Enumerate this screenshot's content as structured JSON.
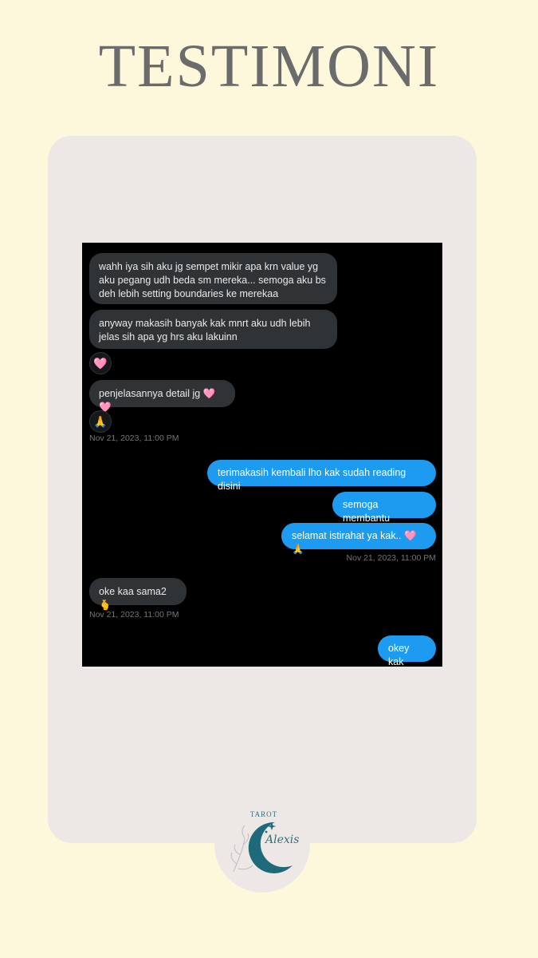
{
  "page": {
    "title": "TESTIMONI",
    "background_color": "#fdf8dc",
    "card_color": "#ede8e5"
  },
  "chat": {
    "incoming": [
      {
        "text": "wahh iya sih aku jg sempet mikir apa krn value yg\naku pegang udh beda sm mereka... semoga aku bs\ndeh lebih setting boundaries ke merekaa"
      },
      {
        "text": "anyway makasih banyak kak mnrt aku udh lebih\njelas sih apa yg hrs aku lakuinn"
      },
      {
        "text": "penjelasannya detail jg 🩷🩷"
      }
    ],
    "reaction_heart": "🩷",
    "reaction_pray": "🙏",
    "timestamp_1": "Nov 21, 2023, 11:00 PM",
    "outgoing": [
      {
        "text": "terimakasih kembali lho kak sudah reading disini"
      },
      {
        "text": "semoga membantu"
      },
      {
        "text": "selamat istirahat ya kak.. 🩷🙏"
      }
    ],
    "timestamp_2": "Nov 21, 2023, 11:00 PM",
    "incoming_2": {
      "text": "oke kaa sama2🫰"
    },
    "timestamp_3": "Nov 21, 2023, 11:00 PM",
    "outgoing_2": {
      "text": "okey kak"
    },
    "colors": {
      "incoming_bubble": "#2f3336",
      "outgoing_bubble": "#1d9bf0",
      "timestamp": "#71767b"
    }
  },
  "logo": {
    "top_text": "TAROT",
    "name": "Alexis",
    "icon": "crescent-moon-icon",
    "color": "#2c6f7e"
  }
}
